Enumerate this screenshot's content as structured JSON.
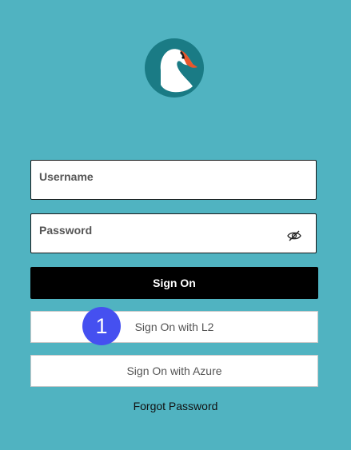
{
  "colors": {
    "background": "#50b3c1",
    "primary_button": "#000000",
    "badge": "#4550f0",
    "logo_teal": "#1a7b85"
  },
  "logo": {
    "icon": "swan-logo-icon"
  },
  "form": {
    "username_placeholder": "Username",
    "password_placeholder": "Password",
    "password_toggle_icon": "eye-slash-icon"
  },
  "buttons": {
    "sign_on": "Sign On",
    "sign_on_l2": "Sign On with L2",
    "sign_on_azure": "Sign On with Azure"
  },
  "annotation": {
    "number": "1"
  },
  "links": {
    "forgot_password": "Forgot Password"
  }
}
